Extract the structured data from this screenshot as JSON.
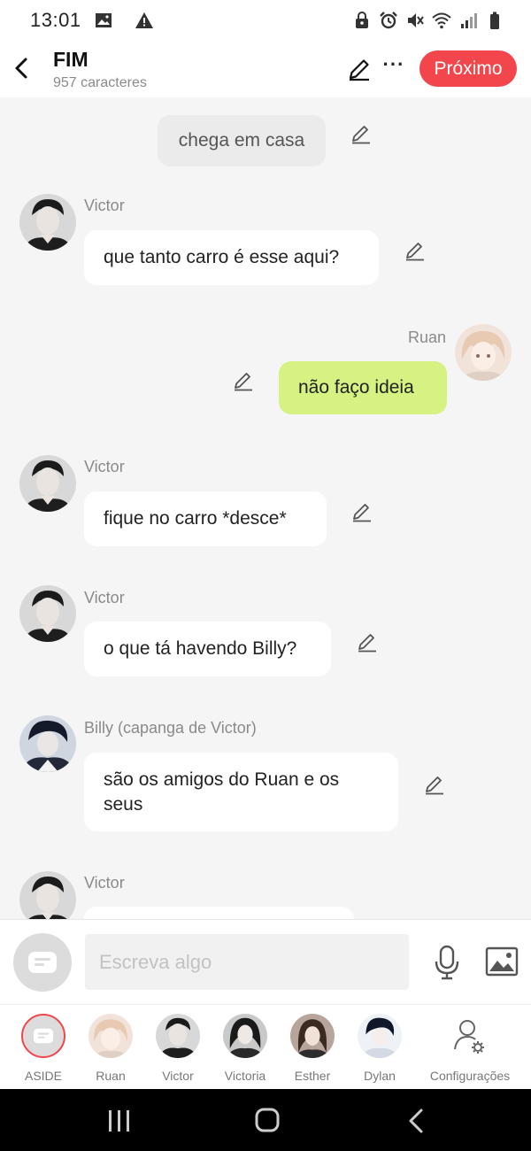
{
  "status_bar": {
    "time": "13:01",
    "left_icons": [
      "gallery-icon",
      "warning-icon"
    ],
    "right_icons": [
      "lock-icon",
      "alarm-icon",
      "mute-icon",
      "wifi-icon",
      "signal-icon",
      "battery-icon"
    ]
  },
  "header": {
    "title": "FIM",
    "subtitle": "957 caracteres",
    "next_label": "Próximo",
    "accent_color": "#f2464c"
  },
  "messages": [
    {
      "type": "narration",
      "text": "chega em casa"
    },
    {
      "type": "incoming",
      "sender": "Victor",
      "text": "que tanto carro é esse aqui?"
    },
    {
      "type": "outgoing",
      "sender": "Ruan",
      "text": "não faço ideia"
    },
    {
      "type": "incoming",
      "sender": "Victor",
      "text": "fique no carro *desce*"
    },
    {
      "type": "incoming",
      "sender": "Victor",
      "text": "o que tá havendo Billy?"
    },
    {
      "type": "incoming",
      "sender": "Billy (capanga de Victor)",
      "text": "são os amigos do Ruan e os seus"
    },
    {
      "type": "incoming",
      "sender": "Victor",
      "text": ""
    }
  ],
  "input": {
    "placeholder": "Escreva algo"
  },
  "characters": [
    {
      "label": "ASIDE"
    },
    {
      "label": "Ruan"
    },
    {
      "label": "Victor"
    },
    {
      "label": "Victoria"
    },
    {
      "label": "Esther"
    },
    {
      "label": "Dylan"
    },
    {
      "label": "Configurações"
    }
  ],
  "colors": {
    "outgoing_bubble": "#d5f283",
    "incoming_bubble": "#ffffff",
    "narration_bubble": "#ebebeb",
    "background": "#f5f5f5"
  }
}
